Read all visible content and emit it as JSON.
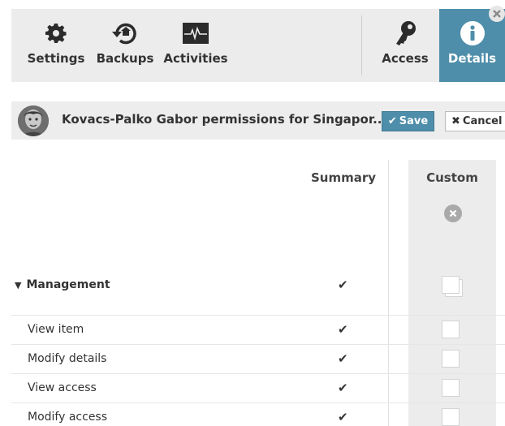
{
  "toolbar": {
    "items": [
      {
        "label": "Settings",
        "icon": "gear-icon"
      },
      {
        "label": "Backups",
        "icon": "backup-icon"
      },
      {
        "label": "Activities",
        "icon": "activity-monitor-icon"
      },
      {
        "label": "Access",
        "icon": "key-icon"
      },
      {
        "label": "Details",
        "icon": "info-icon",
        "active": true
      }
    ]
  },
  "header": {
    "title": "Kovacs-Palko Gabor permissions for Singapor...",
    "save_label": "Save",
    "cancel_label": "Cancel"
  },
  "table": {
    "columns": {
      "summary": "Summary",
      "custom": "Custom"
    },
    "rows": [
      {
        "label": "Management",
        "group": true,
        "summary": "✔",
        "custom": false
      },
      {
        "label": "View item",
        "summary": "✔",
        "custom": false
      },
      {
        "label": "Modify details",
        "summary": "✔",
        "custom": false
      },
      {
        "label": "View access",
        "summary": "✔",
        "custom": false
      },
      {
        "label": "Modify access",
        "summary": "✔",
        "custom": false
      }
    ]
  },
  "colors": {
    "accent": "#4f8eaa",
    "toolbar_bg": "#ececec"
  }
}
